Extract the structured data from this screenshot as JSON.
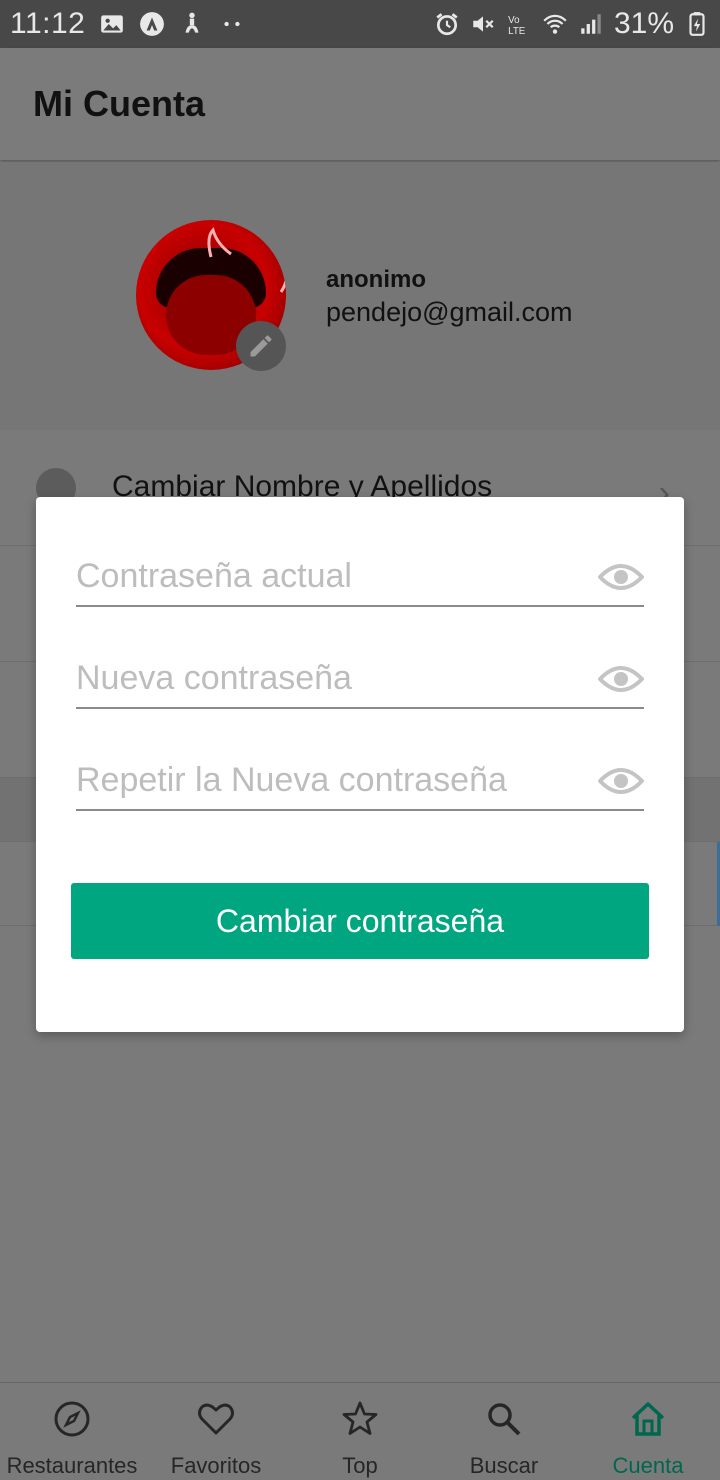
{
  "status_bar": {
    "time": "11:12",
    "battery": "31%"
  },
  "app_bar": {
    "title": "Mi Cuenta"
  },
  "profile": {
    "name": "anonimo",
    "email": "pendejo@gmail.com"
  },
  "options": {
    "items": [
      {
        "label": "Cambiar Nombre  y Apellidos"
      }
    ]
  },
  "modal": {
    "fields": [
      {
        "placeholder": "Contraseña actual",
        "value": ""
      },
      {
        "placeholder": "Nueva contraseña",
        "value": ""
      },
      {
        "placeholder": "Repetir la Nueva contraseña",
        "value": ""
      }
    ],
    "submit_label": "Cambiar contraseña"
  },
  "bottom_nav": {
    "items": [
      {
        "label": "Restaurantes",
        "icon": "compass-icon"
      },
      {
        "label": "Favoritos",
        "icon": "heart-icon"
      },
      {
        "label": "Top",
        "icon": "star-icon"
      },
      {
        "label": "Buscar",
        "icon": "search-icon"
      },
      {
        "label": "Cuenta",
        "icon": "home-icon",
        "active": true
      }
    ]
  },
  "colors": {
    "accent": "#00a680",
    "active_nav": "#00674f",
    "overlay_gray": "#7a7a7a"
  }
}
